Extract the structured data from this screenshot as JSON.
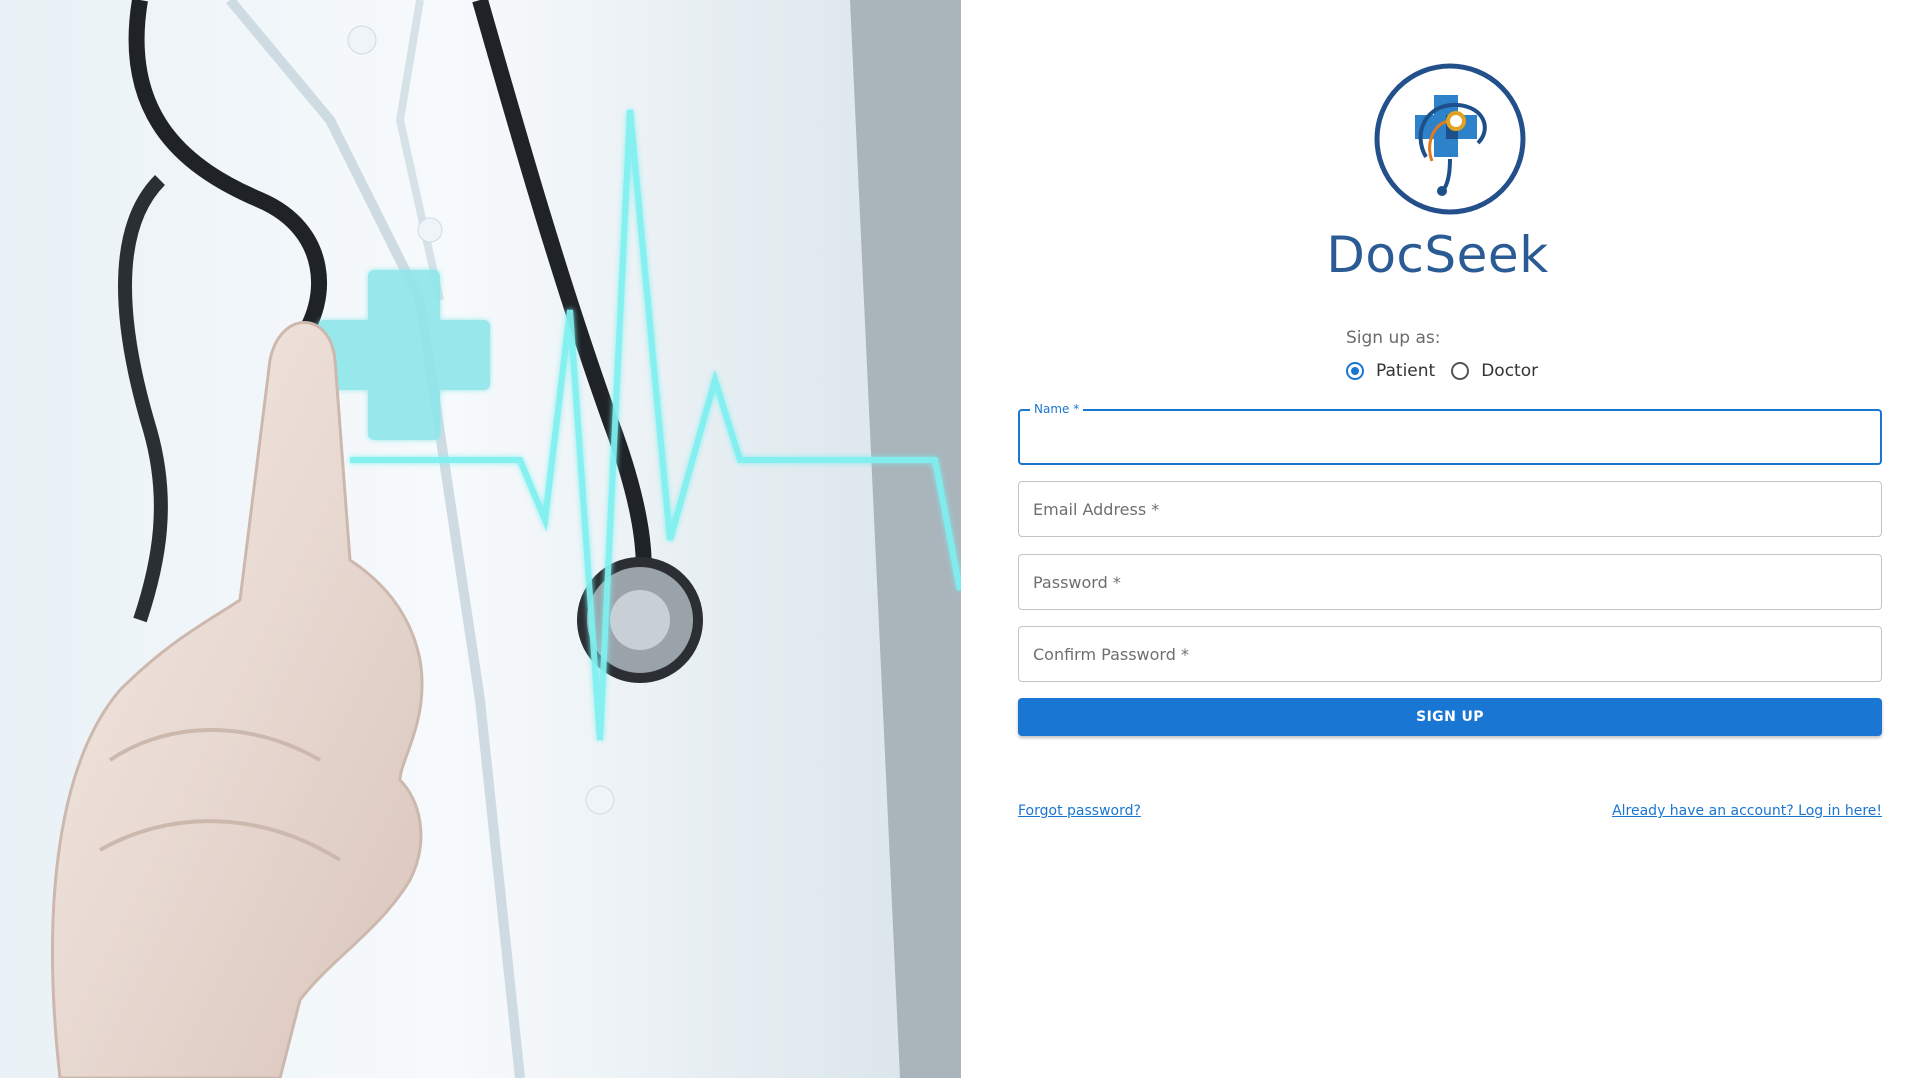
{
  "brand": {
    "name": "DocSeek",
    "color": "#2a5b94"
  },
  "form": {
    "signup_as_label": "Sign up as:",
    "roles": [
      {
        "label": "Patient",
        "selected": true
      },
      {
        "label": "Doctor",
        "selected": false
      }
    ],
    "fields": {
      "name": {
        "label": "Name *",
        "value": ""
      },
      "email": {
        "placeholder": "Email Address *",
        "value": ""
      },
      "password": {
        "placeholder": "Password *",
        "value": ""
      },
      "confirm_password": {
        "placeholder": "Confirm Password *",
        "value": ""
      }
    },
    "submit_label": "SIGN UP"
  },
  "links": {
    "forgot_password": "Forgot password?",
    "login": "Already have an account? Log in here!"
  },
  "colors": {
    "primary": "#1976d2",
    "border": "#c4c4c4"
  }
}
